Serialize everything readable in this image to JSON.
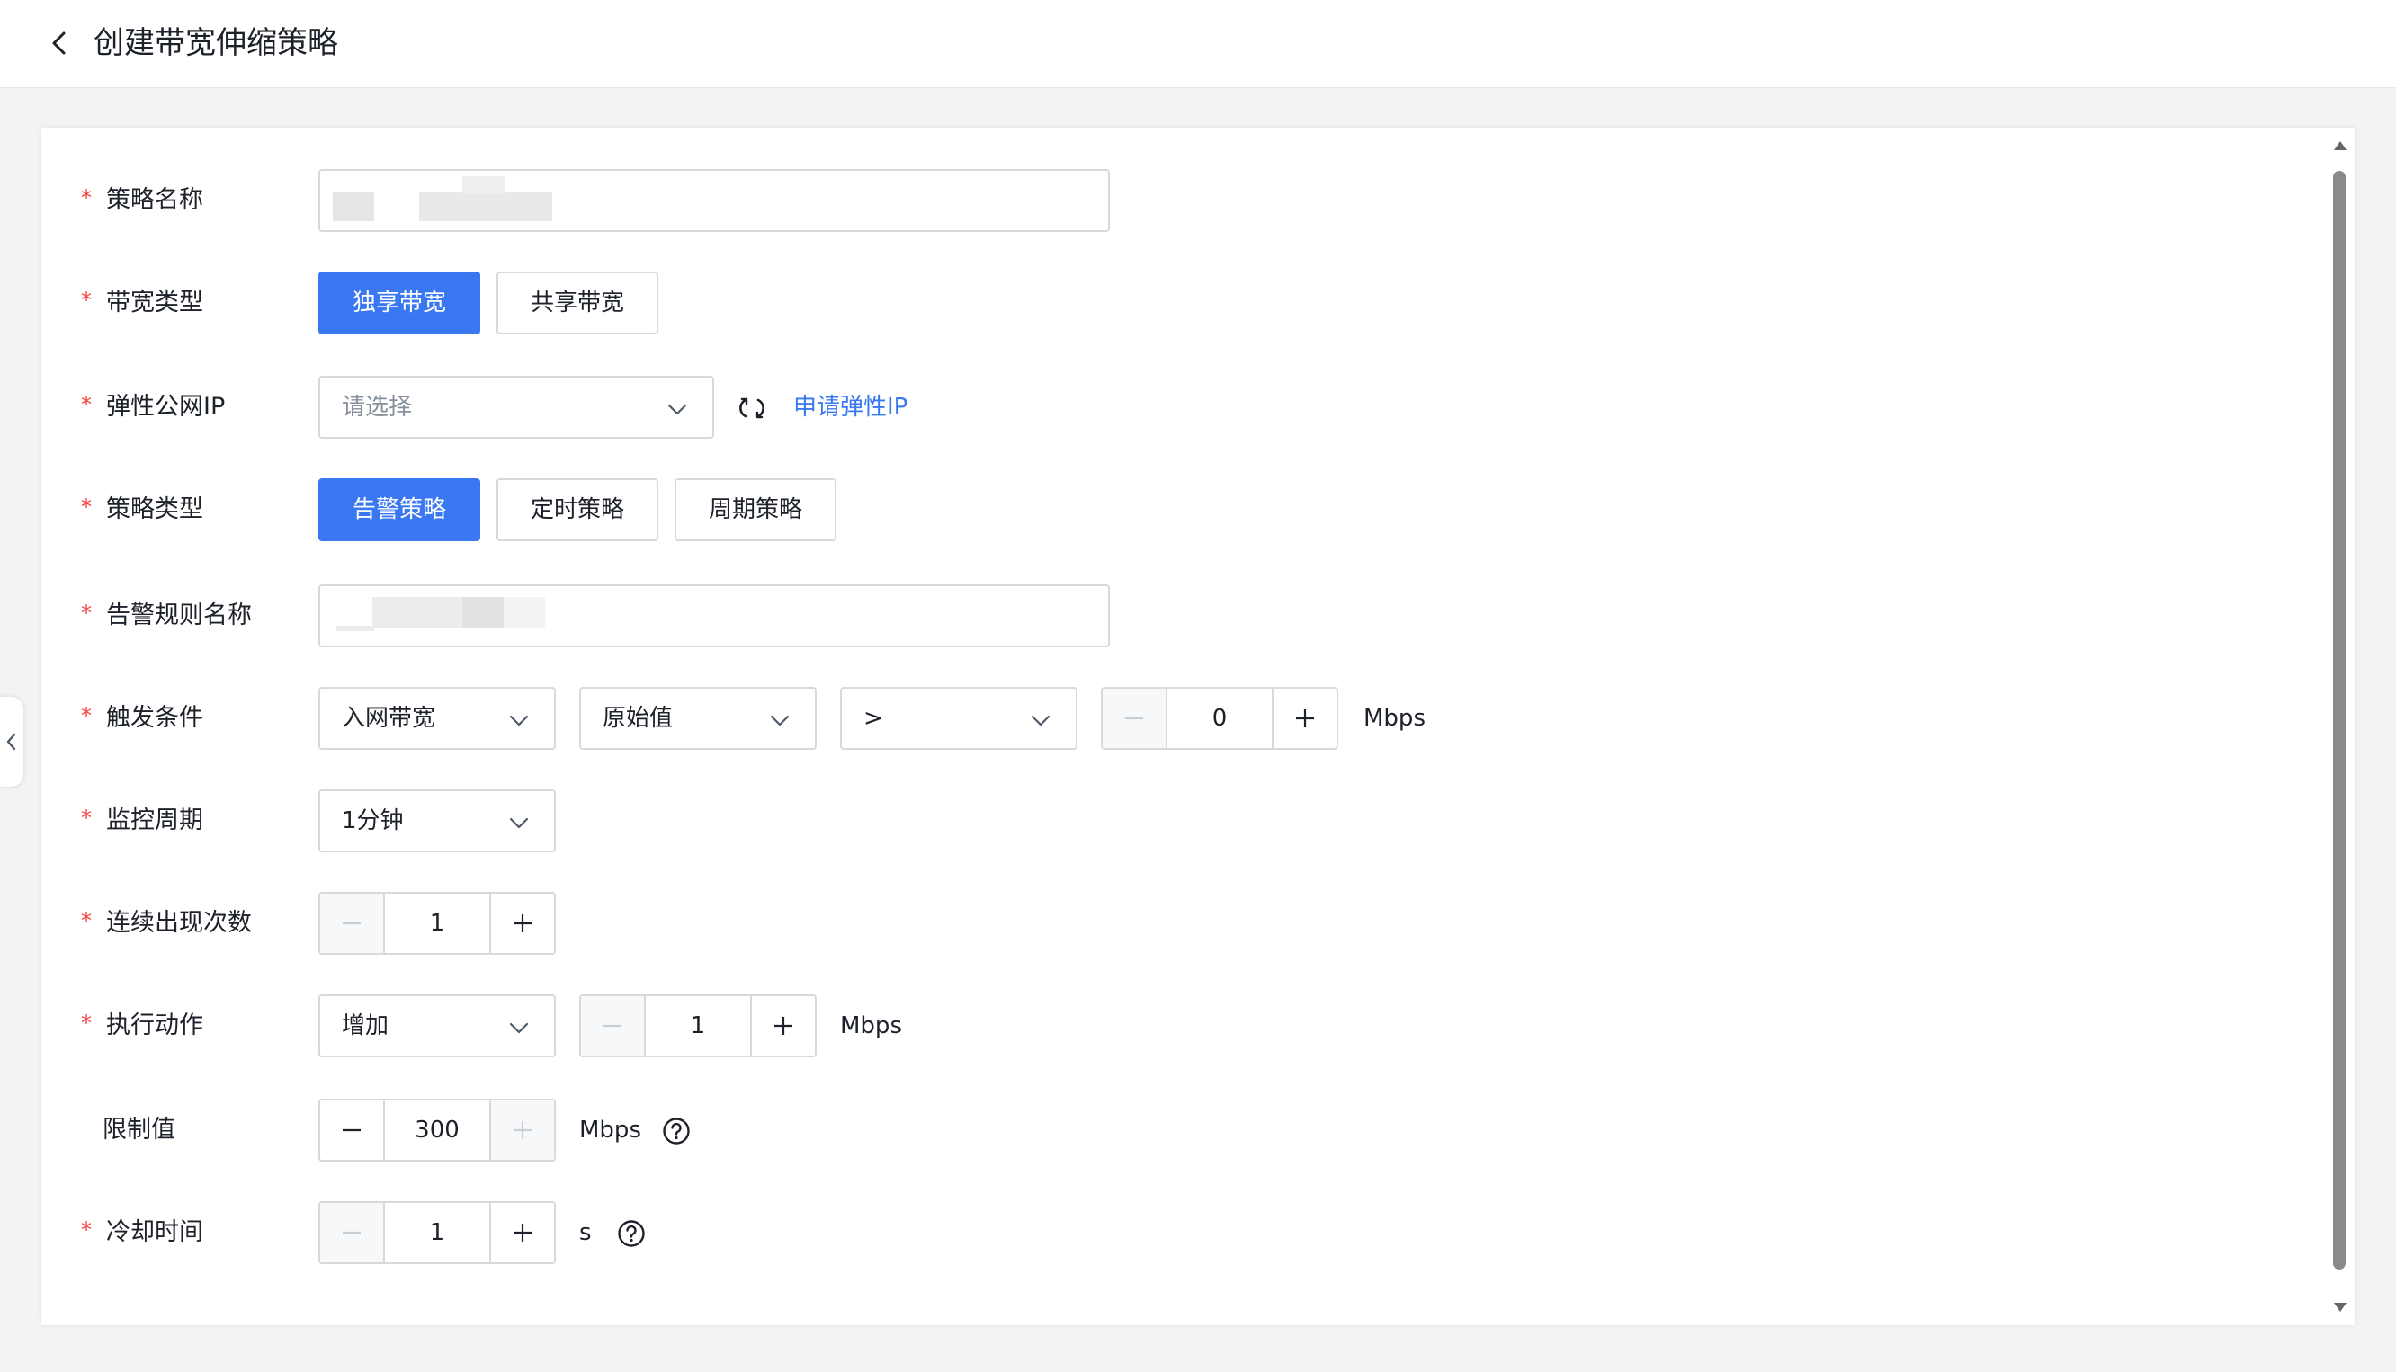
{
  "header": {
    "title": "创建带宽伸缩策略"
  },
  "form": {
    "policy_name": {
      "label": "策略名称"
    },
    "bandwidth_type": {
      "label": "带宽类型",
      "options": [
        "独享带宽",
        "共享带宽"
      ],
      "selected": "独享带宽"
    },
    "eip": {
      "label": "弹性公网IP",
      "placeholder": "请选择",
      "apply_link": "申请弹性IP"
    },
    "policy_type": {
      "label": "策略类型",
      "options": [
        "告警策略",
        "定时策略",
        "周期策略"
      ],
      "selected": "告警策略"
    },
    "alarm_rule_name": {
      "label": "告警规则名称"
    },
    "trigger": {
      "label": "触发条件",
      "metric": "入网带宽",
      "stat": "原始值",
      "operator": ">",
      "value": "0",
      "unit": "Mbps"
    },
    "monitor_period": {
      "label": "监控周期",
      "value": "1分钟"
    },
    "consecutive": {
      "label": "连续出现次数",
      "value": "1"
    },
    "action": {
      "label": "执行动作",
      "type": "增加",
      "value": "1",
      "unit": "Mbps"
    },
    "limit": {
      "label": "限制值",
      "value": "300",
      "unit": "Mbps"
    },
    "cooldown": {
      "label": "冷却时间",
      "value": "1",
      "unit": "s"
    }
  },
  "colors": {
    "primary": "#3a78f2",
    "required": "#f53f3f",
    "border": "#d9d9d9",
    "background": "#f2f3f5"
  }
}
